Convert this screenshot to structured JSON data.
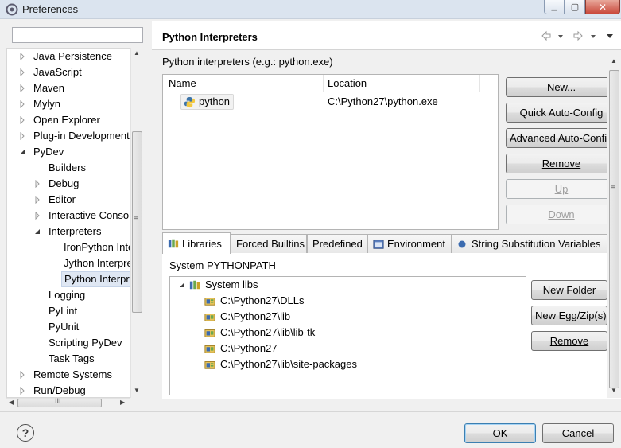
{
  "window": {
    "title": "Preferences",
    "close_glyph": "✕",
    "min_glyph": "▁",
    "max_glyph": "▢"
  },
  "filter": {
    "value": "",
    "placeholder": ""
  },
  "tree": {
    "items": [
      {
        "label": "Java Persistence",
        "expander": "collapsed"
      },
      {
        "label": "JavaScript",
        "expander": "collapsed"
      },
      {
        "label": "Maven",
        "expander": "collapsed"
      },
      {
        "label": "Mylyn",
        "expander": "collapsed"
      },
      {
        "label": "Open Explorer",
        "expander": "collapsed"
      },
      {
        "label": "Plug-in Development",
        "expander": "collapsed"
      },
      {
        "label": "PyDev",
        "expander": "expanded"
      },
      {
        "label": "Builders",
        "expander": "none"
      },
      {
        "label": "Debug",
        "expander": "collapsed"
      },
      {
        "label": "Editor",
        "expander": "collapsed"
      },
      {
        "label": "Interactive Console",
        "expander": "collapsed"
      },
      {
        "label": "Interpreters",
        "expander": "expanded"
      },
      {
        "label": "IronPython Interpreter",
        "expander": "none"
      },
      {
        "label": "Jython Interpreter",
        "expander": "none"
      },
      {
        "label": "Python Interpreter",
        "expander": "none",
        "selected": true
      },
      {
        "label": "Logging",
        "expander": "none"
      },
      {
        "label": "PyLint",
        "expander": "none"
      },
      {
        "label": "PyUnit",
        "expander": "none"
      },
      {
        "label": "Scripting PyDev",
        "expander": "none"
      },
      {
        "label": "Task Tags",
        "expander": "none"
      },
      {
        "label": "Remote Systems",
        "expander": "collapsed"
      },
      {
        "label": "Run/Debug",
        "expander": "collapsed"
      }
    ],
    "hscroll_glyph": "III",
    "vscroll_glyph": "≡"
  },
  "page": {
    "title": "Python Interpreters",
    "interpreters_label": "Python interpreters (e.g.: python.exe)",
    "columns": {
      "name": "Name",
      "location": "Location"
    },
    "interpreters": [
      {
        "name": "python",
        "location": "C:\\Python27\\python.exe"
      }
    ],
    "buttons": {
      "new": "New...",
      "quick_auto_config": "Quick Auto-Config",
      "advanced_auto_config": "Advanced Auto-Config",
      "remove": "Remove",
      "up": "Up",
      "down": "Down"
    }
  },
  "tabs": [
    {
      "label": "Libraries",
      "icon": "libraries-icon",
      "active": true
    },
    {
      "label": "Forced Builtins"
    },
    {
      "label": "Predefined"
    },
    {
      "label": "Environment",
      "icon": "environment-icon"
    },
    {
      "label": "String Substitution Variables",
      "icon": "variables-icon"
    }
  ],
  "libraries": {
    "system_label": "System PYTHONPATH",
    "root": "System libs",
    "paths": [
      "C:\\Python27\\DLLs",
      "C:\\Python27\\lib",
      "C:\\Python27\\lib\\lib-tk",
      "C:\\Python27",
      "C:\\Python27\\lib\\site-packages"
    ],
    "buttons": {
      "new_folder": "New Folder",
      "new_egg_zip": "New Egg/Zip(s)",
      "remove": "Remove"
    }
  },
  "footer": {
    "help_glyph": "?",
    "ok": "OK",
    "cancel": "Cancel"
  },
  "colors": {
    "selection": "#dfe7f3",
    "titlebar": "#dbe4ef",
    "close": "#c9483a"
  }
}
